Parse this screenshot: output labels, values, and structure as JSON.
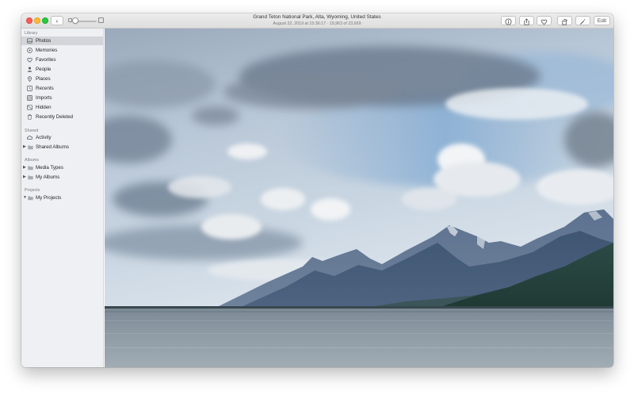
{
  "window": {
    "title": "Grand Teton National Park, Alta, Wyoming, United States",
    "subtitle": "August 22, 2019 at 15:36:17  ·  19,963 of 23,669"
  },
  "toolbar": {
    "back_icon": "chevron-left-icon",
    "zoom_level": 0.1,
    "edit_label": "Edit",
    "buttons": [
      "info-icon",
      "share-icon",
      "heart-icon",
      "rotate-icon",
      "enhance-wand-icon"
    ]
  },
  "sidebar": {
    "library_header": "Library",
    "library": [
      {
        "label": "Photos",
        "icon": "photos-icon",
        "selected": true
      },
      {
        "label": "Memories",
        "icon": "memories-icon"
      },
      {
        "label": "Favorites",
        "icon": "heart-icon"
      },
      {
        "label": "People",
        "icon": "person-icon"
      },
      {
        "label": "Places",
        "icon": "pin-icon"
      },
      {
        "label": "Recents",
        "icon": "clock-icon"
      },
      {
        "label": "Imports",
        "icon": "import-icon"
      },
      {
        "label": "Hidden",
        "icon": "hidden-icon"
      },
      {
        "label": "Recently Deleted",
        "icon": "trash-icon"
      }
    ],
    "shared_header": "Shared",
    "shared": [
      {
        "label": "Activity",
        "icon": "cloud-icon"
      },
      {
        "label": "Shared Albums",
        "icon": "folder-icon",
        "expandable": true
      }
    ],
    "albums_header": "Albums",
    "albums": [
      {
        "label": "Media Types",
        "icon": "folder-icon",
        "expandable": true
      },
      {
        "label": "My Albums",
        "icon": "folder-icon",
        "expandable": true
      }
    ],
    "projects_header": "Projects",
    "projects": [
      {
        "label": "My Projects",
        "icon": "folder-icon",
        "expandable": true,
        "expanded": true
      }
    ]
  },
  "colors": {
    "close": "#fc5f57",
    "minimize": "#fdbc2e",
    "maximize": "#28c940",
    "sidebar_bg": "#eef0f3",
    "selection": "#d2d5da"
  }
}
